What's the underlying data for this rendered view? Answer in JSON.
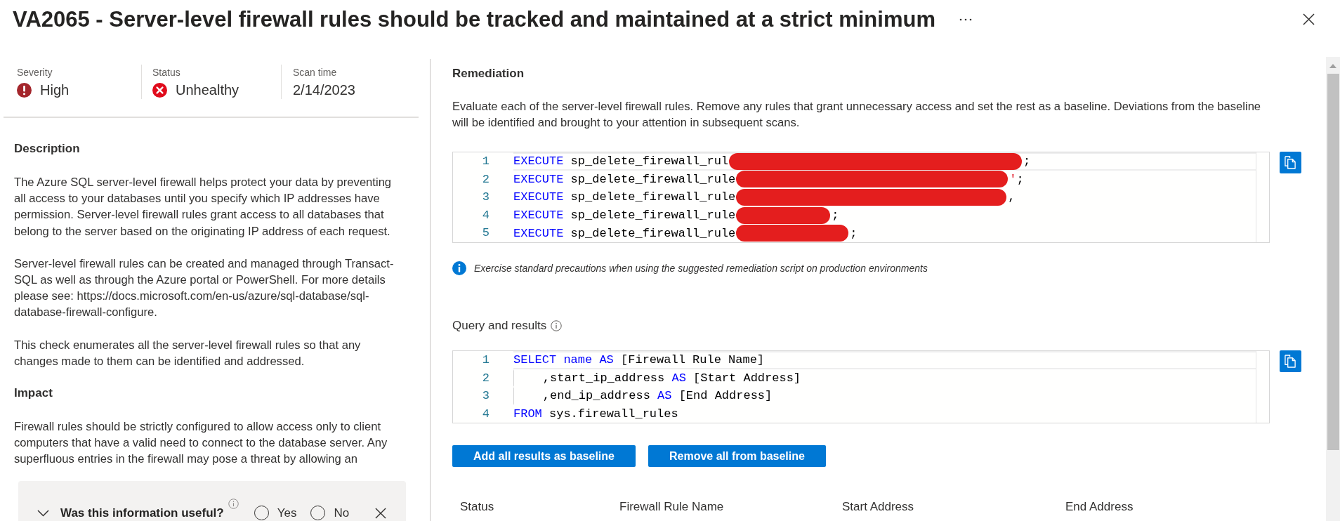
{
  "panel": {
    "title": "VA2065 - Server-level firewall rules should be tracked and maintained at a strict minimum"
  },
  "summary": [
    {
      "kind": "severity",
      "label": "Severity",
      "value": "High"
    },
    {
      "kind": "status",
      "label": "Status",
      "value": "Unhealthy"
    },
    {
      "kind": "date",
      "label": "Scan time",
      "value": "2/14/2023"
    }
  ],
  "description": {
    "heading": "Description",
    "paragraphs": [
      "The Azure SQL server-level firewall helps protect your data by preventing all access to your databases until you specify which IP addresses have permission. Server-level firewall rules grant access to all databases that belong to the server based on the originating IP address of each request.",
      "Server-level firewall rules can be created and managed through Transact-SQL as well as through the Azure portal or PowerShell. For more details please see: https://docs.microsoft.com/en-us/azure/sql-database/sql-database-firewall-configure.",
      "This check enumerates all the server-level firewall rules so that any changes made to them can be identified and addressed."
    ]
  },
  "impact": {
    "heading": "Impact",
    "paragraphs": [
      "Firewall rules should be strictly configured to allow access only to client computers that have a valid need to connect to the database server. Any superfluous entries in the firewall may pose a threat by allowing an"
    ]
  },
  "feedback": {
    "question": "Was this information useful?",
    "options": [
      {
        "label": "Yes",
        "selected": false
      },
      {
        "label": "No",
        "selected": false
      }
    ]
  },
  "remediation": {
    "heading": "Remediation",
    "text": "Evaluate each of the server-level firewall rules. Remove any rules that grant unnecessary access and set the rest as a baseline. Deviations from the baseline will be identified and brought to your attention in subsequent scans.",
    "code": [
      {
        "number": "1",
        "current": true,
        "tokens": [
          {
            "kind": "keyword",
            "text": "EXECUTE"
          },
          {
            "kind": "plain",
            "text": " sp_delete_firewall_rul"
          },
          {
            "kind": "redacted"
          },
          {
            "kind": "plain",
            "text": ";"
          }
        ]
      },
      {
        "number": "2",
        "current": false,
        "tokens": [
          {
            "kind": "keyword",
            "text": "EXECUTE"
          },
          {
            "kind": "plain",
            "text": " sp_delete_firewall_rule"
          },
          {
            "kind": "redacted"
          },
          {
            "kind": "string",
            "text": "'"
          },
          {
            "kind": "plain",
            "text": ";"
          }
        ]
      },
      {
        "number": "3",
        "current": false,
        "tokens": [
          {
            "kind": "keyword",
            "text": "EXECUTE"
          },
          {
            "kind": "plain",
            "text": " sp_delete_firewall_rule"
          },
          {
            "kind": "redacted"
          },
          {
            "kind": "plain",
            "text": ","
          }
        ]
      },
      {
        "number": "4",
        "current": false,
        "tokens": [
          {
            "kind": "keyword",
            "text": "EXECUTE"
          },
          {
            "kind": "plain",
            "text": " sp_delete_firewall_rule"
          },
          {
            "kind": "redacted"
          },
          {
            "kind": "plain",
            "text": ";"
          }
        ]
      },
      {
        "number": "5",
        "current": false,
        "tokens": [
          {
            "kind": "keyword",
            "text": "EXECUTE"
          },
          {
            "kind": "plain",
            "text": " sp_delete_firewall_rule"
          },
          {
            "kind": "redacted"
          },
          {
            "kind": "plain",
            "text": ";"
          }
        ]
      }
    ],
    "note": "Exercise standard precautions when using the suggested remediation script on production environments"
  },
  "query": {
    "heading": "Query and results",
    "code": [
      {
        "number": "1",
        "current": true,
        "tokens": [
          {
            "kind": "keyword",
            "text": "SELECT name AS"
          },
          {
            "kind": "plain",
            "text": " [Firewall Rule Name]"
          }
        ]
      },
      {
        "number": "2",
        "current": false,
        "tokens": [
          {
            "kind": "plain",
            "text": "    ,start_ip_address "
          },
          {
            "kind": "keyword",
            "text": "AS"
          },
          {
            "kind": "plain",
            "text": " [Start Address]"
          }
        ]
      },
      {
        "number": "3",
        "current": false,
        "tokens": [
          {
            "kind": "plain",
            "text": "    ,end_ip_address "
          },
          {
            "kind": "keyword",
            "text": "AS"
          },
          {
            "kind": "plain",
            "text": " [End Address]"
          }
        ]
      },
      {
        "number": "4",
        "current": false,
        "tokens": [
          {
            "kind": "keyword",
            "text": "FROM"
          },
          {
            "kind": "plain",
            "text": " sys.firewall_rules"
          }
        ]
      }
    ],
    "buttons": [
      "Add all results as baseline",
      "Remove all from baseline"
    ]
  },
  "table": {
    "columns": [
      "Status",
      "Firewall Rule Name",
      "Start Address",
      "End Address"
    ]
  }
}
